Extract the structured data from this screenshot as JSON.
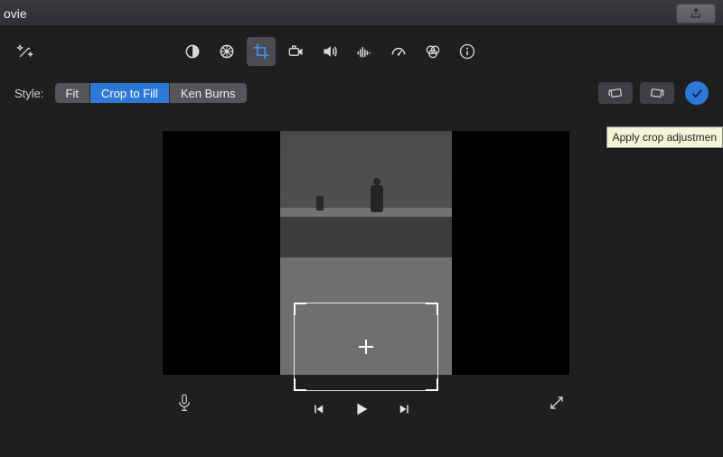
{
  "titlebar": {
    "title": "ovie"
  },
  "toolbar": {
    "icons": {
      "autoEnhance": "auto-enhance-icon",
      "balance": "color-balance-icon",
      "colorWheel": "color-wheel-icon",
      "crop": "crop-icon",
      "stabilize": "stabilize-icon",
      "volume": "volume-icon",
      "equalizer": "equalizer-icon",
      "speed": "speed-icon",
      "filters": "filters-icon",
      "info": "info-icon"
    }
  },
  "styleRow": {
    "label": "Style:",
    "options": {
      "fit": "Fit",
      "cropToFill": "Crop to Fill",
      "kenBurns": "Ken Burns"
    },
    "selected": "cropToFill"
  },
  "tooltip": "Apply crop adjustmen",
  "transport": {
    "mic": "microphone-icon",
    "prev": "previous-icon",
    "play": "play-icon",
    "next": "next-icon",
    "fullscreen": "fullscreen-icon"
  },
  "colors": {
    "accent": "#2f78d8"
  }
}
